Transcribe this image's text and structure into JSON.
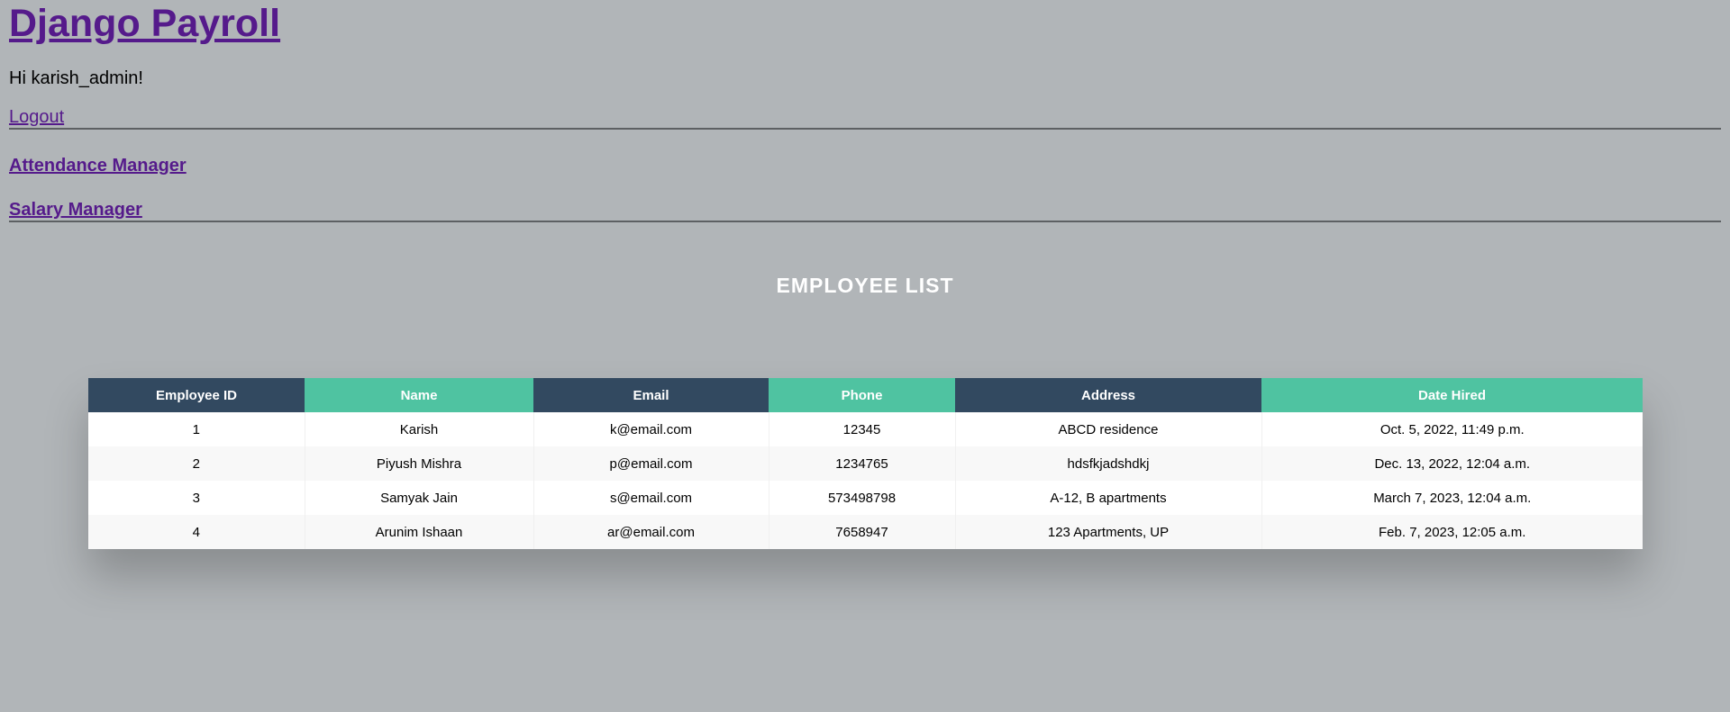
{
  "header": {
    "title": "Django Payroll",
    "greeting": "Hi karish_admin!",
    "logout_label": "Logout"
  },
  "nav": {
    "attendance_label": "Attendance Manager",
    "salary_label": "Salary Manager"
  },
  "employee_list": {
    "heading": "EMPLOYEE LIST",
    "columns": [
      "Employee ID",
      "Name",
      "Email",
      "Phone",
      "Address",
      "Date Hired"
    ],
    "rows": [
      [
        "1",
        "Karish",
        "k@email.com",
        "12345",
        "ABCD residence",
        "Oct. 5, 2022, 11:49 p.m."
      ],
      [
        "2",
        "Piyush Mishra",
        "p@email.com",
        "1234765",
        "hdsfkjadshdkj",
        "Dec. 13, 2022, 12:04 a.m."
      ],
      [
        "3",
        "Samyak Jain",
        "s@email.com",
        "573498798",
        "A-12, B apartments",
        "March 7, 2023, 12:04 a.m."
      ],
      [
        "4",
        "Arunim Ishaan",
        "ar@email.com",
        "7658947",
        "123 Apartments, UP",
        "Feb. 7, 2023, 12:05 a.m."
      ]
    ]
  },
  "colors": {
    "background": "#b1b5b8",
    "header_dark": "#324960",
    "header_green": "#4fc3a1",
    "link": "#551a8b"
  }
}
